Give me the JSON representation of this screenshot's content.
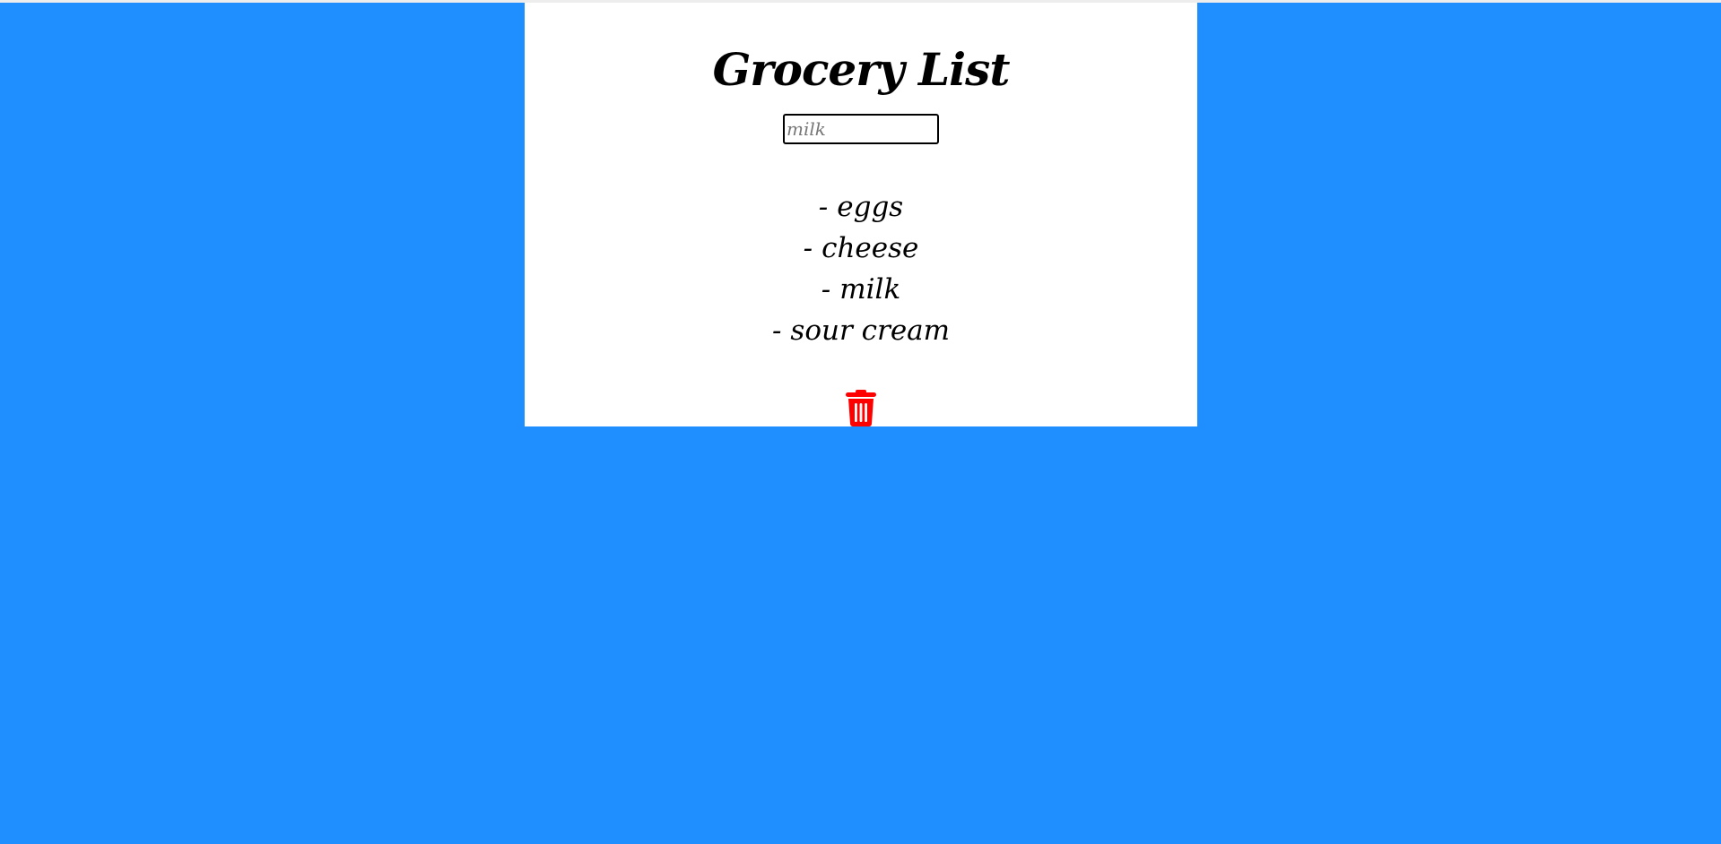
{
  "page": {
    "background_color": "#1f8fff",
    "card_color": "#ffffff"
  },
  "header": {
    "title": "Grocery List"
  },
  "input": {
    "placeholder": "milk",
    "value": ""
  },
  "list": {
    "bullet": "-",
    "items": [
      {
        "label": "eggs"
      },
      {
        "label": "cheese"
      },
      {
        "label": "milk"
      },
      {
        "label": "sour cream"
      }
    ]
  },
  "actions": {
    "delete_icon": "trash-icon",
    "delete_color": "#ff0000"
  }
}
